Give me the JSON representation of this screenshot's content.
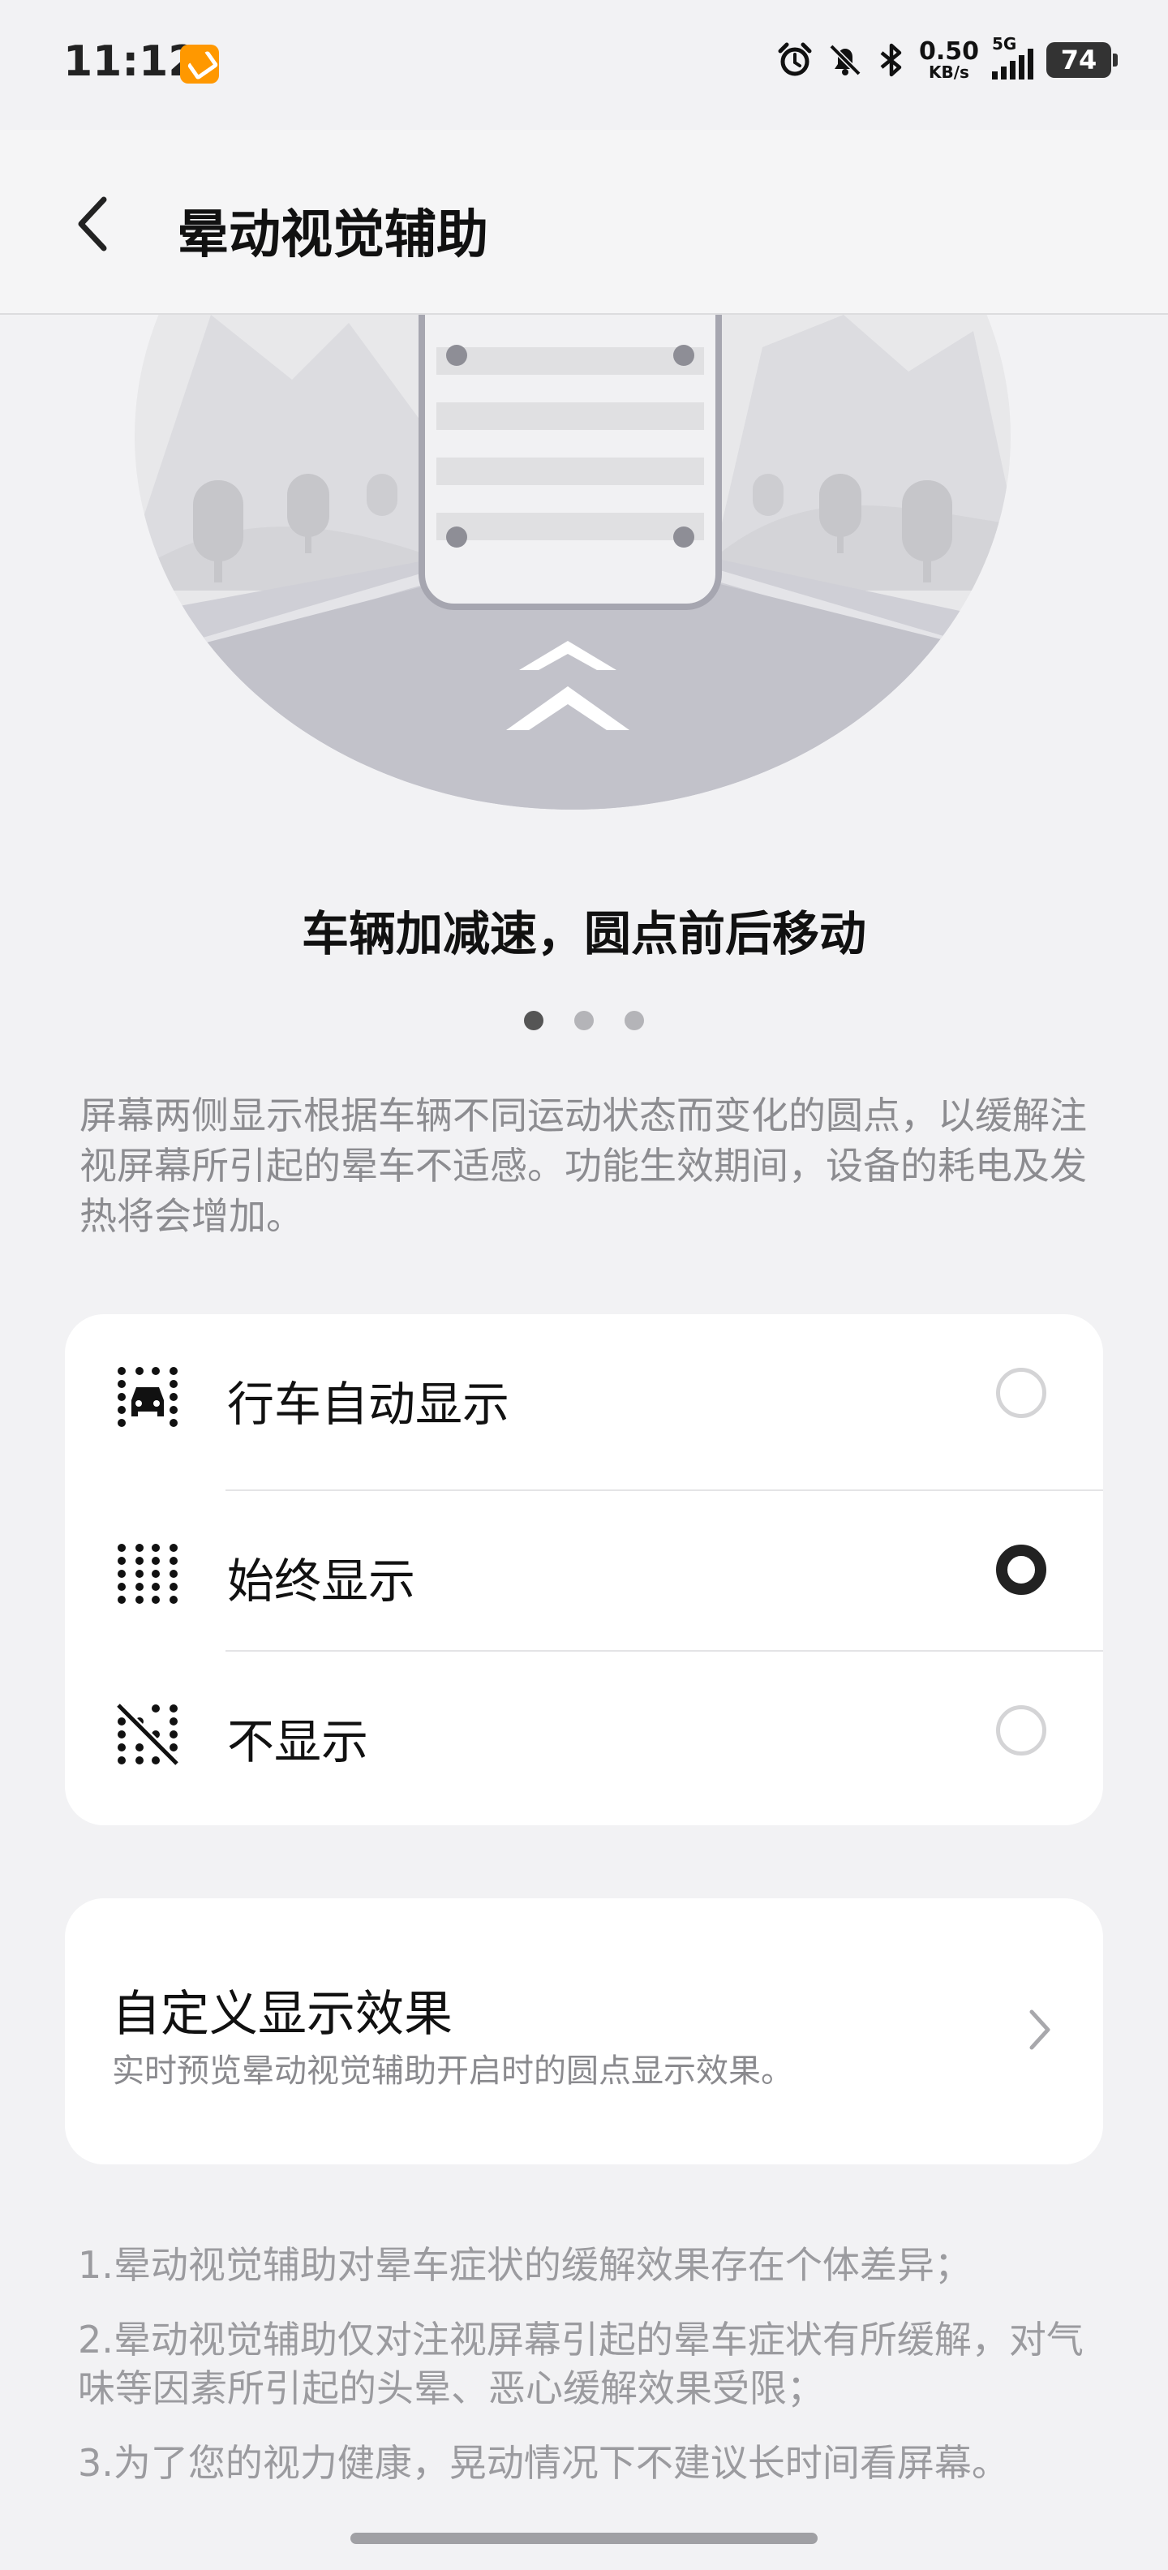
{
  "status_bar": {
    "time": "11:12",
    "net_speed_value": "0.50",
    "net_speed_unit": "KB/s",
    "network": "5G",
    "battery": "74",
    "icons": [
      "app-badge-icon",
      "alarm-icon",
      "bell-off-icon",
      "bluetooth-icon",
      "signal-icon",
      "battery-icon"
    ]
  },
  "header": {
    "title": "晕动视觉辅助",
    "back_icon": "chevron-left-icon"
  },
  "illustration": {
    "caption": "车辆加减速，圆点前后移动",
    "pages": 3,
    "active_page": 1
  },
  "description": "屏幕两侧显示根据车辆不同运动状态而变化的圆点，以缓解注视屏幕所引起的晕车不适感。功能生效期间，设备的耗电及发热将会增加。",
  "options": [
    {
      "label": "行车自动显示",
      "icon": "car-dots-icon",
      "selected": false
    },
    {
      "label": "始终显示",
      "icon": "dots-grid-icon",
      "selected": true
    },
    {
      "label": "不显示",
      "icon": "dots-off-icon",
      "selected": false
    }
  ],
  "custom": {
    "title": "自定义显示效果",
    "subtitle": "实时预览晕动视觉辅助开启时的圆点显示效果。",
    "icon": "chevron-right-icon"
  },
  "notes": [
    "1.晕动视觉辅助对晕车症状的缓解效果存在个体差异；",
    "2.晕动视觉辅助仅对注视屏幕引起的晕车症状有所缓解，对气味等因素所引起的头晕、恶心缓解效果受限；",
    "3.为了您的视力健康，晃动情况下不建议长时间看屏幕。"
  ]
}
